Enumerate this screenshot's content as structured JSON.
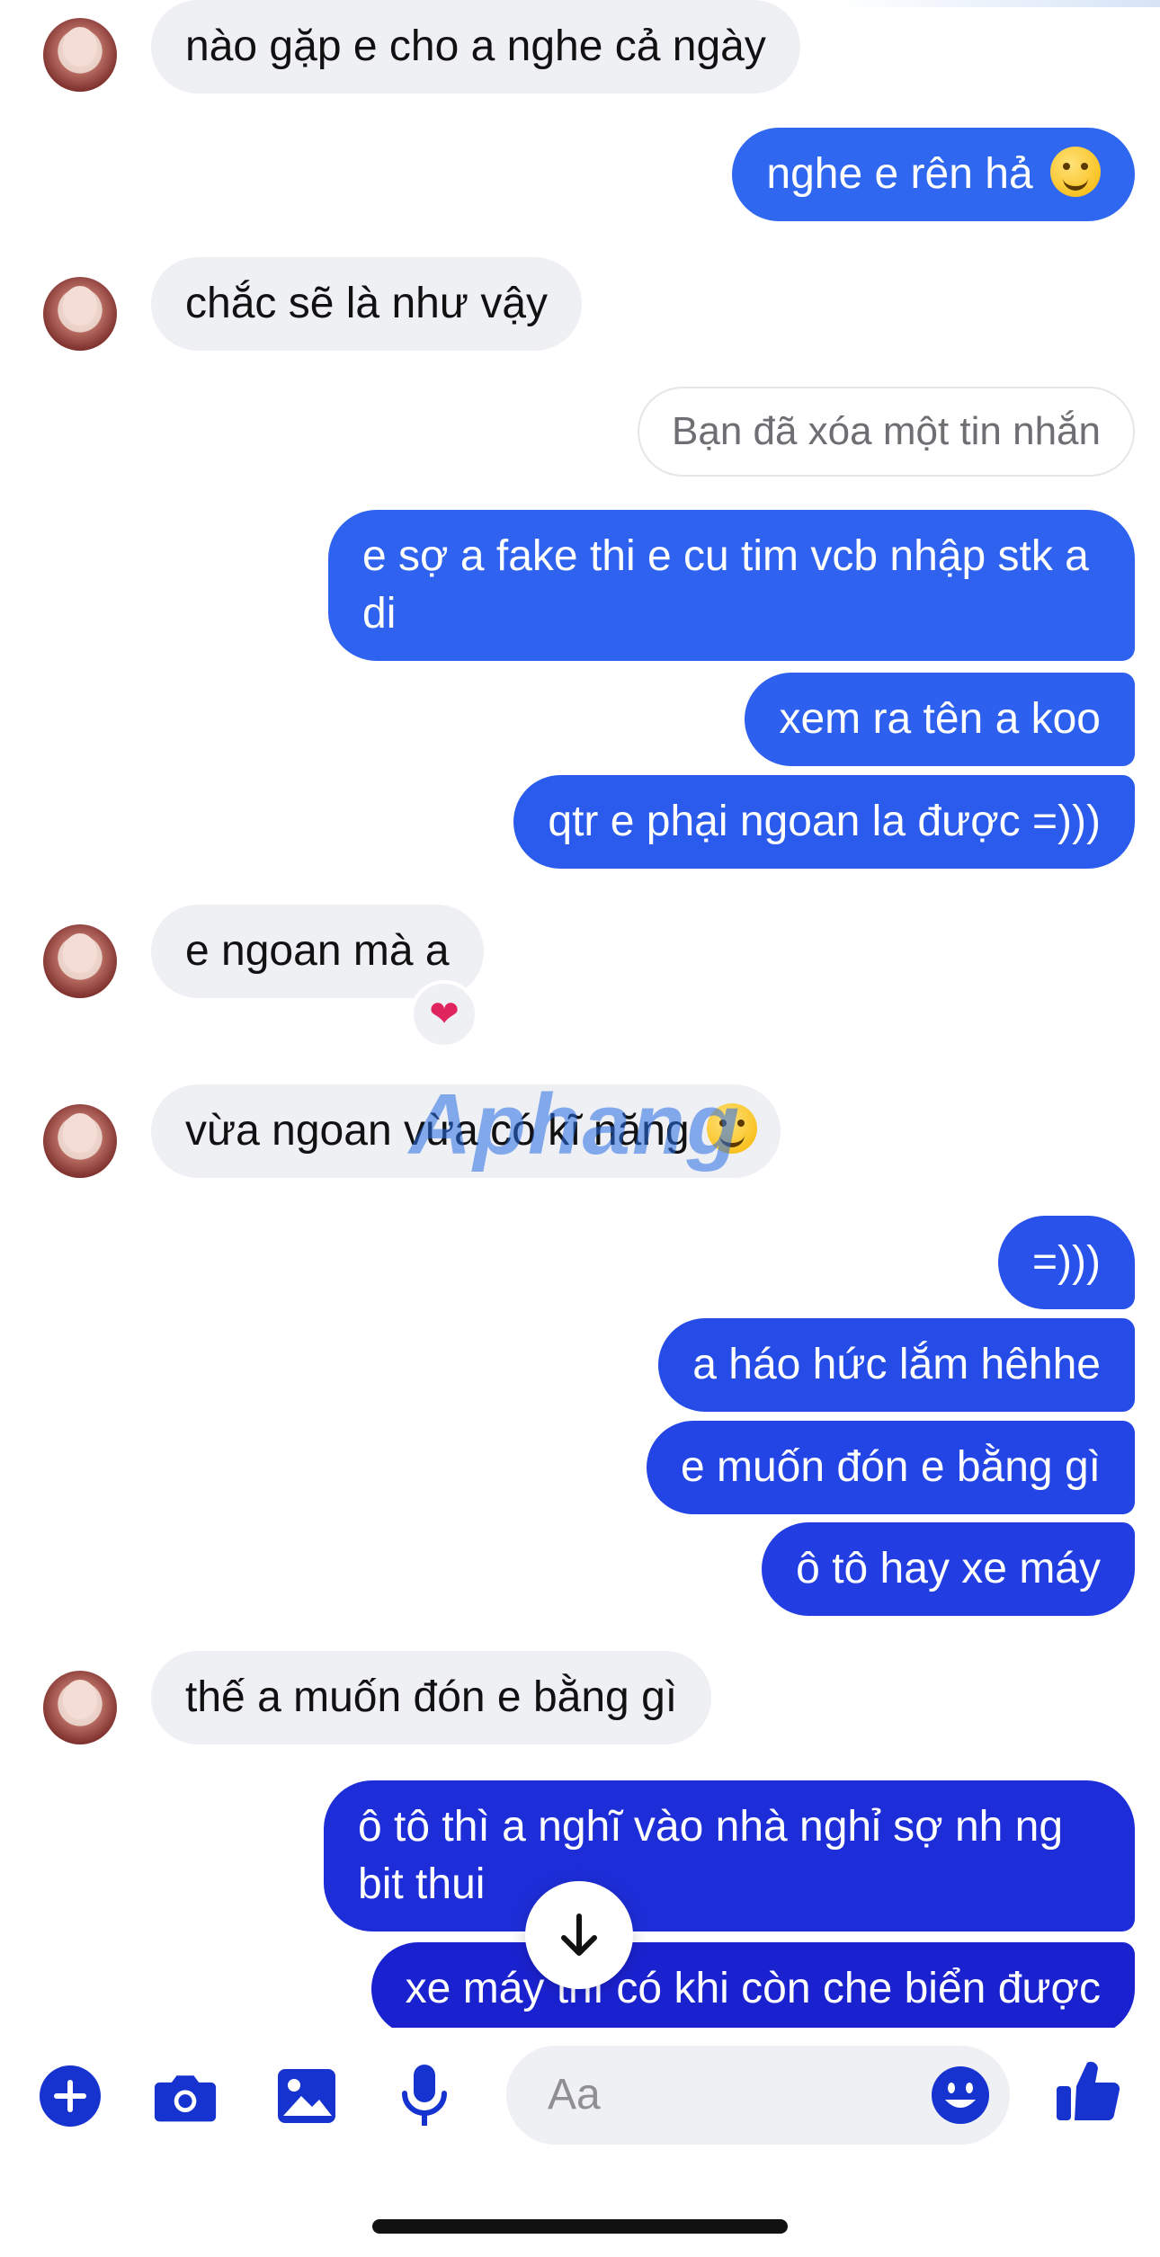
{
  "colors": {
    "incoming_bubble": "#eff0f4",
    "outgoing_top": "#2f67f0",
    "outgoing_bottom": "#1a1fcf",
    "accent_icon": "#1733cf"
  },
  "watermark": {
    "text": "Aphang"
  },
  "messages": [
    {
      "id": "m1",
      "side": "in",
      "text": "nào gặp e cho a nghe cả ngày"
    },
    {
      "id": "m2",
      "side": "out",
      "text": "nghe e rên hả",
      "emoji": "yum-face-emoji"
    },
    {
      "id": "m3",
      "side": "in",
      "text": "chắc sẽ là như vậy"
    },
    {
      "id": "m4",
      "side": "deleted",
      "text": "Bạn đã xóa một tin nhắn"
    },
    {
      "id": "m5",
      "side": "out",
      "text": "e sợ a fake thi e cu tim vcb nhập stk a di"
    },
    {
      "id": "m6",
      "side": "out",
      "text": "xem ra tên a koo"
    },
    {
      "id": "m7",
      "side": "out",
      "text": "qtr e phại ngoan la được =)))"
    },
    {
      "id": "m8",
      "side": "in",
      "text": "e ngoan mà a",
      "reaction": "❤"
    },
    {
      "id": "m9",
      "side": "in",
      "text": "vừa ngoan vừa có kĩ năng",
      "emoji": "smirk-face-emoji"
    },
    {
      "id": "m10",
      "side": "out",
      "text": "=)))"
    },
    {
      "id": "m11",
      "side": "out",
      "text": "a háo hức lắm hêhhe"
    },
    {
      "id": "m12",
      "side": "out",
      "text": "e muốn đón e bằng gì"
    },
    {
      "id": "m13",
      "side": "out",
      "text": "ô tô hay xe máy"
    },
    {
      "id": "m14",
      "side": "in",
      "text": "thế a muốn đón e bằng gì"
    },
    {
      "id": "m15",
      "side": "out",
      "text": "ô tô thì a nghĩ vào nhà nghỉ sợ nh ng bit thui"
    },
    {
      "id": "m16",
      "side": "out",
      "text": "xe máy thì có khi còn che biển được"
    }
  ],
  "composer": {
    "placeholder": "Aa",
    "icons": [
      "plus-icon",
      "camera-icon",
      "image-icon",
      "microphone-icon",
      "emoji-icon",
      "thumbs-up-icon"
    ]
  }
}
